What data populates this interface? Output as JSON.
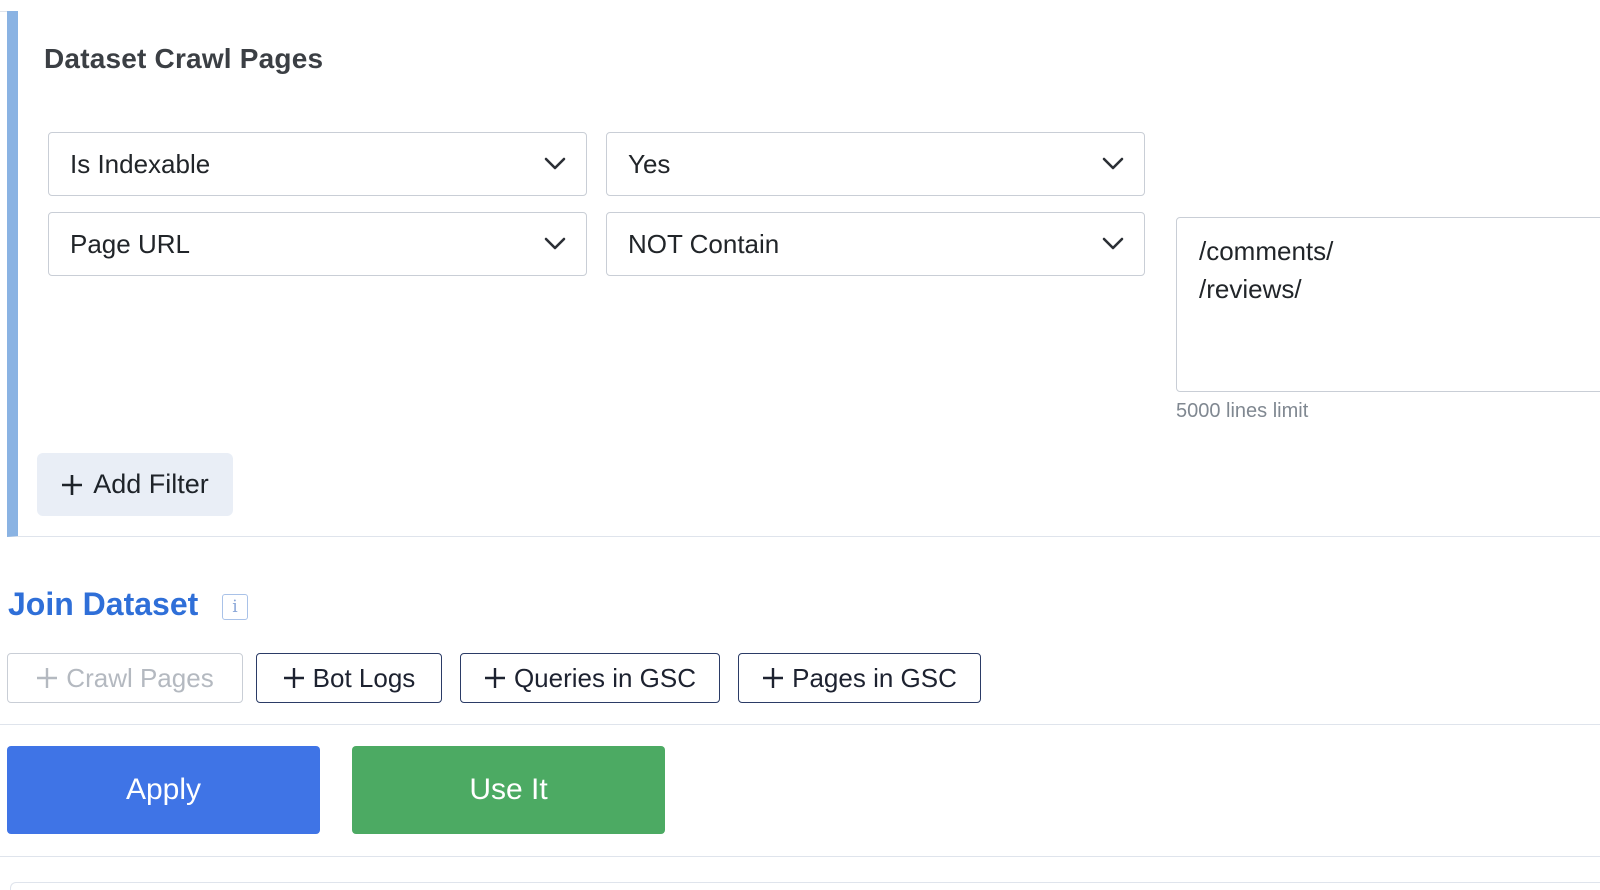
{
  "panel": {
    "title": "Dataset Crawl Pages",
    "filters": [
      {
        "field": "Is Indexable",
        "operator": "Yes"
      },
      {
        "field": "Page URL",
        "operator": "NOT Contain",
        "value": "/comments/\n/reviews/",
        "hint": "5000 lines limit"
      }
    ],
    "add_filter_label": "Add Filter"
  },
  "join": {
    "title": "Join Dataset",
    "info_glyph": "i",
    "chips": [
      {
        "label": "Crawl Pages",
        "disabled": true
      },
      {
        "label": "Bot Logs",
        "disabled": false
      },
      {
        "label": "Queries in GSC",
        "disabled": false
      },
      {
        "label": "Pages in GSC",
        "disabled": false
      }
    ]
  },
  "actions": {
    "apply_label": "Apply",
    "use_it_label": "Use It",
    "apply_color": "#3f74e6",
    "use_it_color": "#4caa63"
  },
  "colors": {
    "accent_bar": "#8ab3e3",
    "join_title": "#2f6fd8"
  },
  "icons": {
    "dropdown": "chevron-down-icon",
    "add": "plus-icon",
    "info": "info-icon"
  }
}
